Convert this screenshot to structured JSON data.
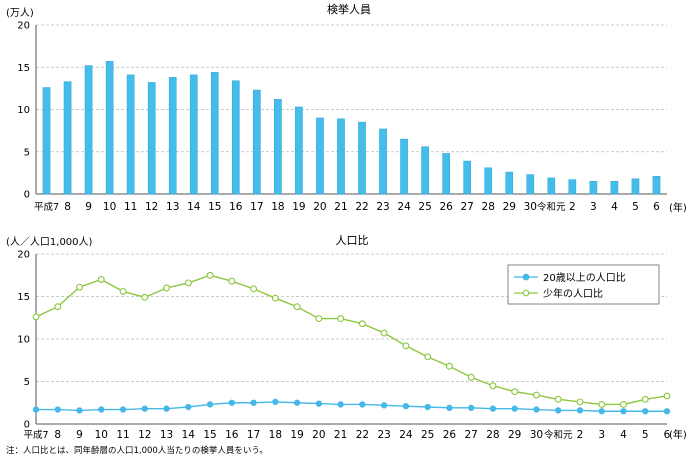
{
  "colors": {
    "bar": "#45bdea",
    "bar_edge": "#2ea3d6",
    "adult_line": "#45b8e8",
    "youth_line": "#8dc63f",
    "grid": "#b8bcc0",
    "axis": "#555555"
  },
  "chart_data": [
    {
      "type": "bar",
      "title": "検挙人員",
      "ylabel": "(万人)",
      "xunit": "(年)",
      "ylim": [
        0,
        20
      ],
      "yticks": [
        0,
        5,
        10,
        15,
        20
      ],
      "grid": true,
      "categories": [
        "平成7",
        "8",
        "9",
        "10",
        "11",
        "12",
        "13",
        "14",
        "15",
        "16",
        "17",
        "18",
        "19",
        "20",
        "21",
        "22",
        "23",
        "24",
        "25",
        "26",
        "27",
        "28",
        "29",
        "30",
        "令和元",
        "2",
        "3",
        "4",
        "5",
        "6"
      ],
      "series": [
        {
          "values": [
            12.6,
            13.3,
            15.2,
            15.7,
            14.1,
            13.2,
            13.8,
            14.1,
            14.4,
            13.4,
            12.3,
            11.2,
            10.3,
            9.0,
            8.9,
            8.5,
            7.7,
            6.5,
            5.6,
            4.8,
            3.9,
            3.1,
            2.6,
            2.3,
            1.9,
            1.7,
            1.5,
            1.5,
            1.8,
            2.1
          ]
        }
      ]
    },
    {
      "type": "line",
      "title": "人口比",
      "ylabel": "(人／人口1,000人)",
      "xunit": "(年)",
      "ylim": [
        0,
        20
      ],
      "yticks": [
        0,
        5,
        10,
        15,
        20
      ],
      "grid": true,
      "legend_position": "top-right",
      "categories": [
        "平成7",
        "8",
        "9",
        "10",
        "11",
        "12",
        "13",
        "14",
        "15",
        "16",
        "17",
        "18",
        "19",
        "20",
        "21",
        "22",
        "23",
        "24",
        "25",
        "26",
        "27",
        "28",
        "29",
        "30",
        "令和元",
        "2",
        "3",
        "4",
        "5",
        "6"
      ],
      "series": [
        {
          "name": "20歳以上の人口比",
          "color_key": "adult_line",
          "values": [
            1.7,
            1.7,
            1.6,
            1.7,
            1.7,
            1.8,
            1.8,
            2.0,
            2.3,
            2.5,
            2.5,
            2.6,
            2.5,
            2.4,
            2.3,
            2.3,
            2.2,
            2.1,
            2.0,
            1.9,
            1.9,
            1.8,
            1.8,
            1.7,
            1.6,
            1.6,
            1.5,
            1.5,
            1.5,
            1.5
          ]
        },
        {
          "name": "少年の人口比",
          "color_key": "youth_line",
          "values": [
            12.6,
            13.8,
            16.1,
            17.0,
            15.6,
            14.9,
            16.0,
            16.6,
            17.5,
            16.8,
            15.9,
            14.8,
            13.8,
            12.4,
            12.4,
            11.8,
            10.7,
            9.2,
            7.9,
            6.8,
            5.5,
            4.5,
            3.8,
            3.4,
            2.9,
            2.6,
            2.3,
            2.3,
            2.9,
            3.3
          ]
        }
      ]
    }
  ],
  "note": "注：人口比とは、同年齢層の人口1,000人当たりの検挙人員をいう。"
}
